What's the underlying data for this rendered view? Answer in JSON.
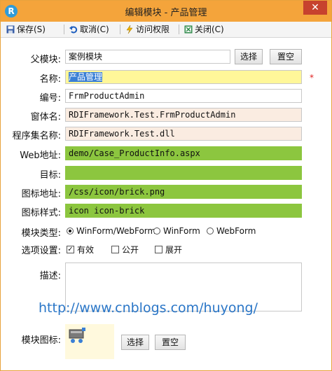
{
  "window": {
    "title": "编辑模块 - 产品管理",
    "app_icon": "R",
    "close_glyph": "✕"
  },
  "toolbar": [
    {
      "label": "保存(S)",
      "icon": "save-icon"
    },
    {
      "label": "取消(C)",
      "icon": "undo-icon"
    },
    {
      "label": "访问权限",
      "icon": "lightning-icon"
    },
    {
      "label": "关闭(C)",
      "icon": "close-window-icon"
    }
  ],
  "form": {
    "parent_module": {
      "label": "父模块:",
      "value": "案例模块",
      "select": "选择",
      "clear": "置空"
    },
    "name": {
      "label": "名称:",
      "value": "产品管理",
      "required": "*"
    },
    "code": {
      "label": "编号:",
      "value": "FrmProductAdmin"
    },
    "form_name": {
      "label": "窗体名:",
      "value": "RDIFramework.Test.FrmProductAdmin"
    },
    "assembly": {
      "label": "程序集名称:",
      "value": "RDIFramework.Test.dll"
    },
    "web_url": {
      "label": "Web地址:",
      "value": "demo/Case_ProductInfo.aspx"
    },
    "target": {
      "label": "目标:",
      "value": ""
    },
    "icon_url": {
      "label": "图标地址:",
      "value": "/css/icon/brick.png"
    },
    "icon_css": {
      "label": "图标样式:",
      "value": "icon icon-brick"
    },
    "module_type": {
      "label": "模块类型:",
      "options": [
        "WinForm/WebForm",
        "WinForm",
        "WebForm"
      ],
      "selected": 0
    },
    "options": {
      "label": "选项设置:",
      "items": [
        {
          "label": "有效",
          "checked": true
        },
        {
          "label": "公开",
          "checked": false
        },
        {
          "label": "展开",
          "checked": false
        }
      ]
    },
    "description": {
      "label": "描述:",
      "value": ""
    },
    "module_icon": {
      "label": "模块图标:",
      "select": "选择",
      "clear": "置空"
    }
  },
  "watermark": "http://www.cnblogs.com/huyong/",
  "colors": {
    "titlebar": "#f4a43b",
    "readonly_bg": "#faece1",
    "web_bg": "#8cc63f",
    "name_bg": "#fff799",
    "selection": "#3a7fd5"
  }
}
